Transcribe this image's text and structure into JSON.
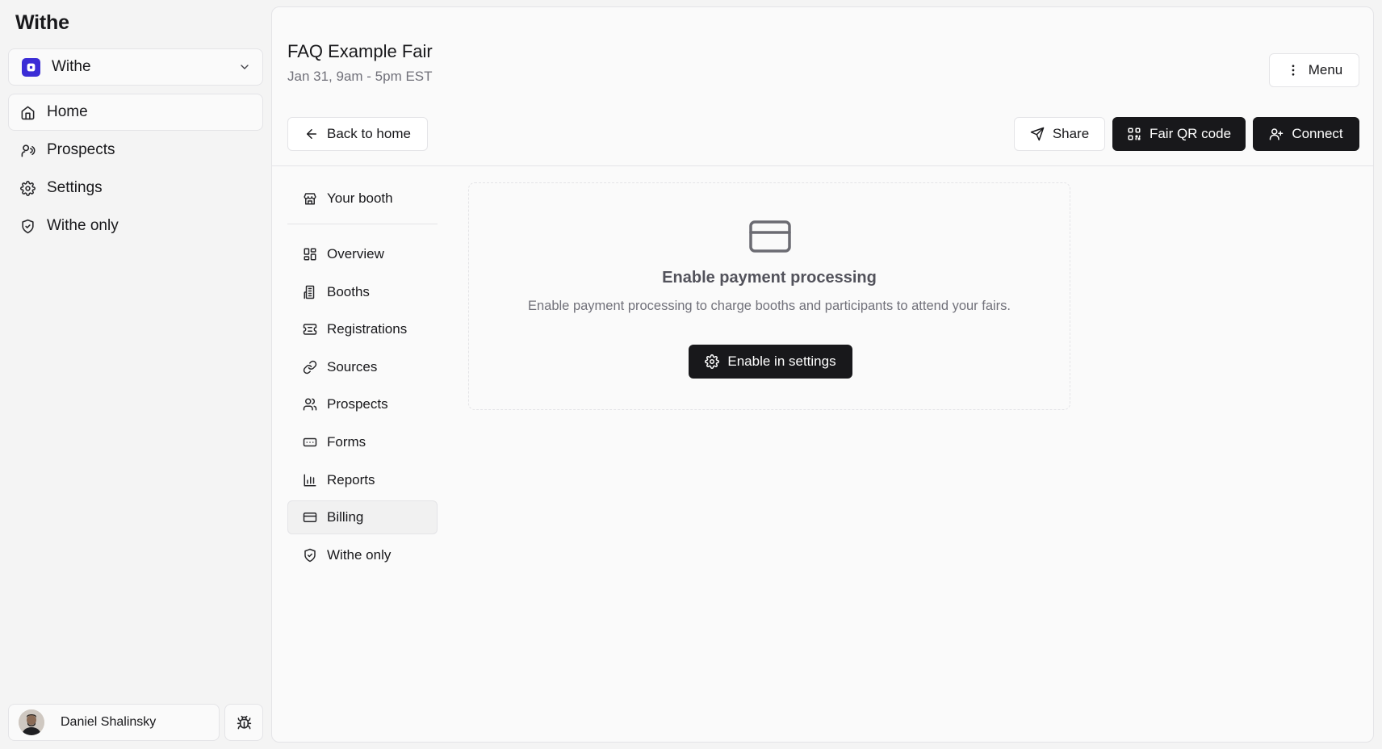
{
  "app": {
    "brand": "Withe",
    "org_switcher": {
      "name": "Withe",
      "icon": "org-logo",
      "chevron": "chevron-down-icon"
    },
    "nav": [
      {
        "label": "Home",
        "icon": "home-icon",
        "active": true
      },
      {
        "label": "Prospects",
        "icon": "radio-user-icon",
        "active": false
      },
      {
        "label": "Settings",
        "icon": "gear-icon",
        "active": false
      },
      {
        "label": "Withe only",
        "icon": "shield-icon",
        "active": false
      }
    ],
    "user": {
      "name": "Daniel Shalinsky"
    },
    "bug_button": {
      "icon": "bug-icon"
    }
  },
  "header": {
    "title": "FAQ Example Fair",
    "subtitle": "Jan 31, 9am - 5pm EST",
    "menu_label": "Menu",
    "back_label": "Back to home",
    "share_label": "Share",
    "qr_label": "Fair QR code",
    "connect_label": "Connect"
  },
  "subnav": {
    "booth": {
      "label": "Your booth",
      "icon": "store-icon"
    },
    "items": [
      {
        "label": "Overview",
        "icon": "grid-icon",
        "active": false
      },
      {
        "label": "Booths",
        "icon": "building-icon",
        "active": false
      },
      {
        "label": "Registrations",
        "icon": "ticket-icon",
        "active": false
      },
      {
        "label": "Sources",
        "icon": "link-icon",
        "active": false
      },
      {
        "label": "Prospects",
        "icon": "users-icon",
        "active": false
      },
      {
        "label": "Forms",
        "icon": "form-input-icon",
        "active": false
      },
      {
        "label": "Reports",
        "icon": "bar-chart-icon",
        "active": false
      },
      {
        "label": "Billing",
        "icon": "credit-card-icon",
        "active": true
      },
      {
        "label": "Withe only",
        "icon": "shield-icon",
        "active": false
      }
    ]
  },
  "billing_empty": {
    "icon": "credit-card-icon",
    "title": "Enable payment processing",
    "description": "Enable payment processing to charge booths and participants to attend your fairs.",
    "button_label": "Enable in settings"
  },
  "colors": {
    "accent_dark": "#18181b",
    "org_logo": "#3b2dd6",
    "border": "#e4e4e7",
    "muted_text": "#71717a"
  }
}
